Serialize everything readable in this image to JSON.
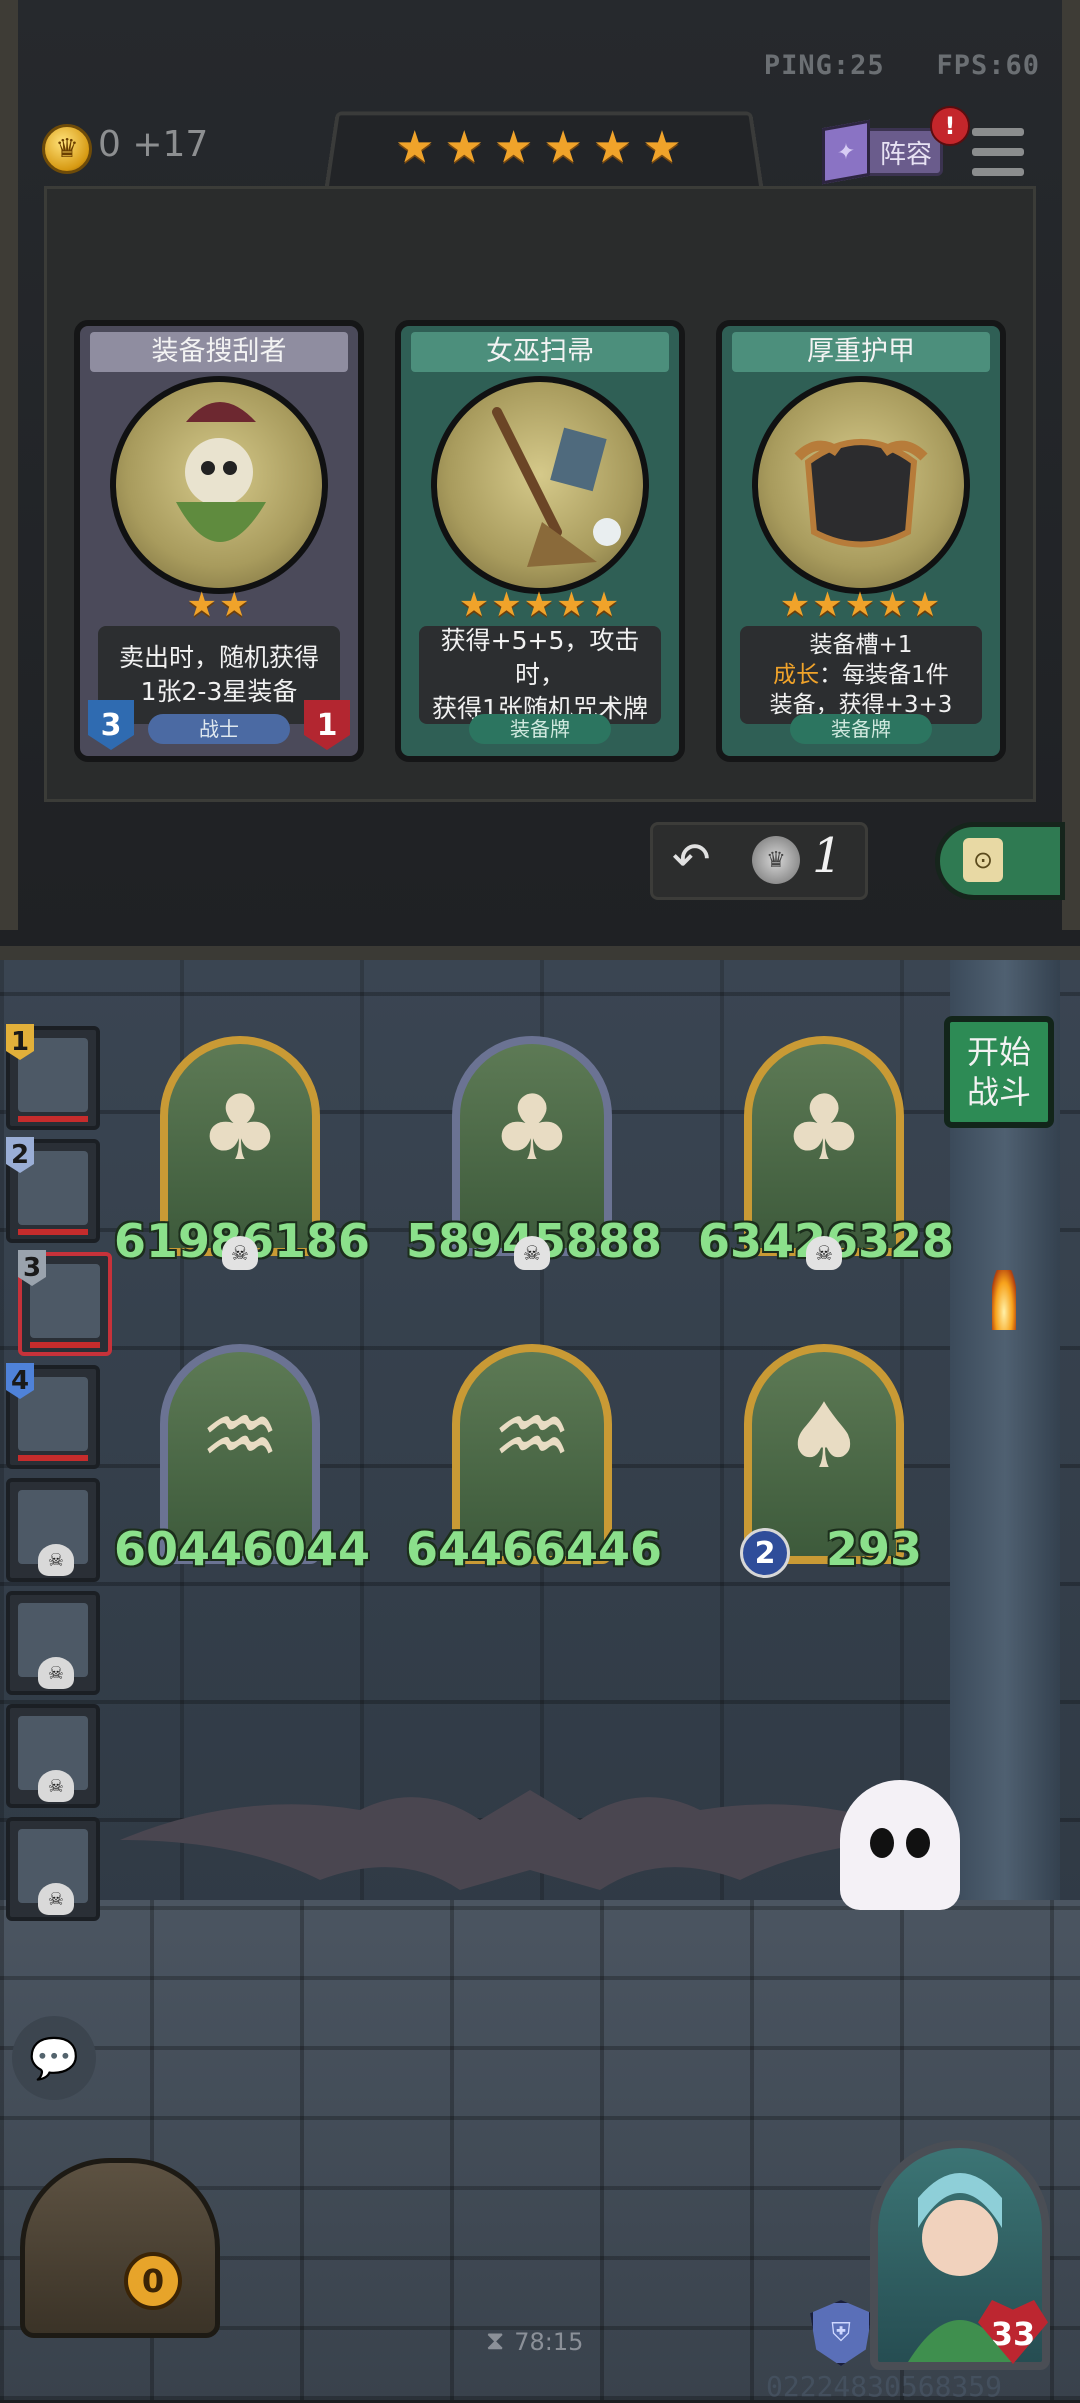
{
  "hud": {
    "ping": "PING:25",
    "fps": "FPS:60",
    "gold": "0 +17",
    "tier_stars": "★★★★★★",
    "lineup_label": "阵容",
    "lineup_alert": "!"
  },
  "shop": {
    "cards": [
      {
        "name": "装备搜刮者",
        "stars": "★★",
        "desc_line1": "卖出时，随机获得",
        "desc_line2": "1张2-3星装备",
        "tag": "战士",
        "attack": "3",
        "health": "1",
        "icon": "goblin-skeleton-icon"
      },
      {
        "name": "女巫扫帚",
        "stars": "★★★★★",
        "desc_line1": "获得+5+5，攻击时，",
        "desc_line2": "获得1张随机咒术牌",
        "tag": "装备牌",
        "icon": "witch-broom-icon"
      },
      {
        "name": "厚重护甲",
        "stars": "★★★★★",
        "desc_line1": "装备槽+1",
        "desc_growth_label": "成长",
        "desc_growth_text": "：每装备1件",
        "desc_line3": "装备，获得+3+3",
        "tag": "装备牌",
        "icon": "heavy-armor-icon"
      }
    ],
    "refresh_cost": "1"
  },
  "queue": [
    {
      "num": "1",
      "color": "#e2b03a"
    },
    {
      "num": "2",
      "color": "#9aaed6"
    },
    {
      "num": "3",
      "color": "#9aa3ad"
    },
    {
      "num": "4",
      "color": "#4f82d9"
    },
    {
      "num": ""
    },
    {
      "num": ""
    },
    {
      "num": ""
    },
    {
      "num": ""
    }
  ],
  "start_battle": {
    "line1": "开始",
    "line2": "战斗"
  },
  "board": {
    "units": [
      {
        "attack": "6198",
        "health": "6186",
        "frame": "gold",
        "icon": "straw-witch-icon"
      },
      {
        "attack": "5894",
        "health": "5888",
        "frame": "silver",
        "icon": "straw-witch-icon"
      },
      {
        "attack": "6342",
        "health": "6328",
        "frame": "gold",
        "icon": "straw-witch-icon"
      },
      {
        "attack": "6044",
        "health": "6044",
        "frame": "silver",
        "icon": "mermaid-icon"
      },
      {
        "attack": "6446",
        "health": "6446",
        "frame": "gold",
        "icon": "mermaid-icon"
      },
      {
        "attack": "",
        "health": "293",
        "level": "2",
        "frame": "gold",
        "icon": "dark-elf-icon"
      }
    ]
  },
  "bottom": {
    "chest_count": "0",
    "timer": "78:15",
    "hero_health": "33",
    "player_id": "02224830568359"
  },
  "colors": {
    "gold_text": "#8d8f91",
    "unit_stat": "#8be08b",
    "accent_star": "#f0a32a",
    "battle_button": "#2d8b55"
  }
}
